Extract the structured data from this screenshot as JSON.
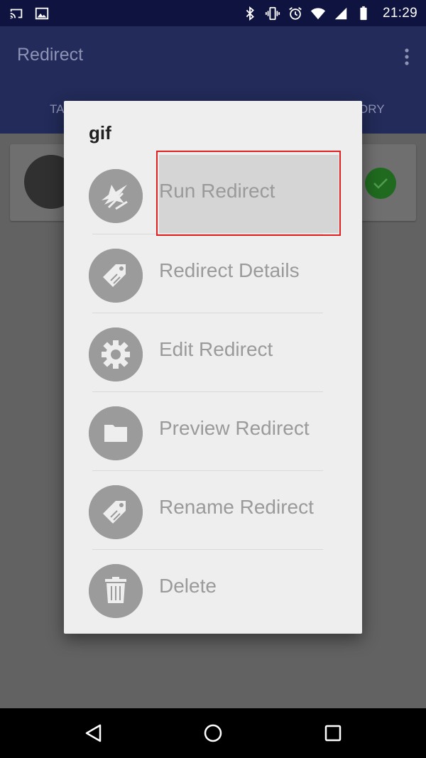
{
  "status_bar": {
    "time": "21:29",
    "icons": [
      "cast-icon",
      "image-icon",
      "bluetooth-icon",
      "vibrate-icon",
      "alarm-icon",
      "wifi-icon",
      "signal-icon",
      "battery-icon"
    ]
  },
  "app_bar": {
    "title": "Redirect",
    "tab_left_partial": "TA",
    "tab_right_partial": "ORY"
  },
  "dialog": {
    "title": "gif",
    "items": [
      {
        "label": "Run Redirect",
        "icon": "redirect-arrows-icon"
      },
      {
        "label": "Redirect Details",
        "icon": "tag-icon"
      },
      {
        "label": "Edit Redirect",
        "icon": "gear-icon"
      },
      {
        "label": "Preview Redirect",
        "icon": "folder-icon"
      },
      {
        "label": "Rename Redirect",
        "icon": "tag-icon"
      },
      {
        "label": "Delete",
        "icon": "trash-icon"
      }
    ]
  },
  "nav_bar": {
    "buttons": [
      "back-icon",
      "home-icon",
      "recents-icon"
    ]
  }
}
